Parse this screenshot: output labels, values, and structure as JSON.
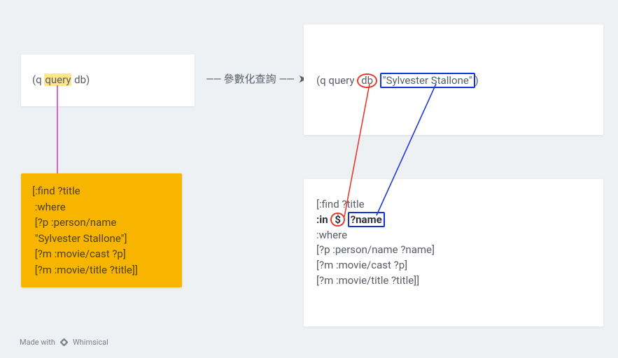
{
  "left_box": {
    "prefix": "(q ",
    "highlight": "query",
    "suffix": " db)"
  },
  "arrow_label": "參數化查詢",
  "right_box": {
    "prefix": "(q query ",
    "circled": "db",
    "space": " ",
    "boxed": "\"Sylvester Stallone\"",
    "suffix": ")"
  },
  "yellow_query": "[:find ?title\n :where\n [?p :person/name\n \"Sylvester Stallone\"]\n [?m :movie/cast ?p]\n [?m :movie/title ?title]]",
  "param_query": {
    "l1": "[:find ?title",
    "l2_prefix": " :in ",
    "l2_circ": "$",
    "l2_sp": " ",
    "l2_box": "?name",
    "l3": " :where",
    "l4": " [?p :person/name ?name]",
    "l5": " [?m :movie/cast ?p]",
    "l6": " [?m :movie/title ?title]]"
  },
  "footer": {
    "made_with": "Made with",
    "brand": "Whimsical"
  },
  "colors": {
    "magenta": "#d63cc6",
    "red": "#e23b2e",
    "blue": "#1f3bd6"
  }
}
